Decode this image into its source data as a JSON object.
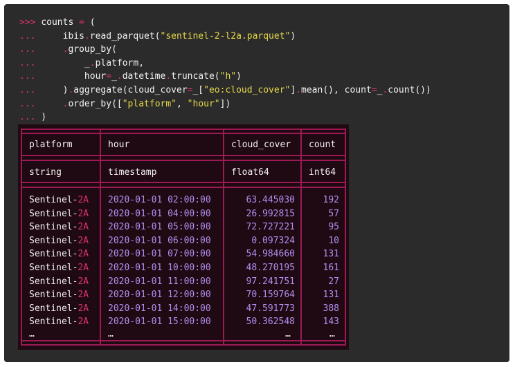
{
  "code": {
    "prompt_primary": ">>>",
    "prompt_continuation": "...",
    "lines": [
      {
        "prompt": ">>>",
        "parts": [
          [
            "fn",
            " counts "
          ],
          [
            "op",
            "="
          ],
          [
            "fn",
            " ("
          ]
        ]
      },
      {
        "prompt": "...",
        "parts": [
          [
            "fn",
            "     ibis"
          ],
          [
            "op",
            "."
          ],
          [
            "fn",
            "read_parquet("
          ],
          [
            "str",
            "\"sentinel-2-l2a.parquet\""
          ],
          [
            "fn",
            ")"
          ]
        ]
      },
      {
        "prompt": "...",
        "parts": [
          [
            "fn",
            "     "
          ],
          [
            "op",
            "."
          ],
          [
            "fn",
            "group_by("
          ]
        ]
      },
      {
        "prompt": "...",
        "parts": [
          [
            "fn",
            "         _"
          ],
          [
            "op",
            "."
          ],
          [
            "fn",
            "platform,"
          ]
        ]
      },
      {
        "prompt": "...",
        "parts": [
          [
            "fn",
            "         hour"
          ],
          [
            "op",
            "="
          ],
          [
            "fn",
            "_"
          ],
          [
            "op",
            "."
          ],
          [
            "fn",
            "datetime"
          ],
          [
            "op",
            "."
          ],
          [
            "fn",
            "truncate("
          ],
          [
            "str",
            "\"h\""
          ],
          [
            "fn",
            ")"
          ]
        ]
      },
      {
        "prompt": "...",
        "parts": [
          [
            "fn",
            "     )"
          ],
          [
            "op",
            "."
          ],
          [
            "fn",
            "aggregate(cloud_cover"
          ],
          [
            "op",
            "="
          ],
          [
            "fn",
            "_["
          ],
          [
            "str",
            "\"eo:cloud_cover\""
          ],
          [
            "fn",
            "]"
          ],
          [
            "op",
            "."
          ],
          [
            "fn",
            "mean(), count"
          ],
          [
            "op",
            "="
          ],
          [
            "fn",
            "_"
          ],
          [
            "op",
            "."
          ],
          [
            "fn",
            "count())"
          ]
        ]
      },
      {
        "prompt": "...",
        "parts": [
          [
            "fn",
            "     "
          ],
          [
            "op",
            "."
          ],
          [
            "fn",
            "order_by(["
          ],
          [
            "str",
            "\"platform\""
          ],
          [
            "fn",
            ", "
          ],
          [
            "str",
            "\"hour\""
          ],
          [
            "fn",
            "])"
          ]
        ]
      },
      {
        "prompt": "...",
        "parts": [
          [
            "fn",
            " )"
          ]
        ]
      }
    ]
  },
  "table": {
    "columns": [
      "platform",
      "hour",
      "cloud_cover",
      "count"
    ],
    "types": [
      "string",
      "timestamp",
      "float64",
      "int64"
    ],
    "rows": [
      {
        "platform_prefix": "Sentinel-",
        "platform_num": "2A",
        "hour": "2020-01-01 02:00:00",
        "cloud_cover": "63.445030",
        "count": "192"
      },
      {
        "platform_prefix": "Sentinel-",
        "platform_num": "2A",
        "hour": "2020-01-01 04:00:00",
        "cloud_cover": "26.992815",
        "count": "57"
      },
      {
        "platform_prefix": "Sentinel-",
        "platform_num": "2A",
        "hour": "2020-01-01 05:00:00",
        "cloud_cover": "72.727221",
        "count": "95"
      },
      {
        "platform_prefix": "Sentinel-",
        "platform_num": "2A",
        "hour": "2020-01-01 06:00:00",
        "cloud_cover": "0.097324",
        "count": "10"
      },
      {
        "platform_prefix": "Sentinel-",
        "platform_num": "2A",
        "hour": "2020-01-01 07:00:00",
        "cloud_cover": "54.984660",
        "count": "131"
      },
      {
        "platform_prefix": "Sentinel-",
        "platform_num": "2A",
        "hour": "2020-01-01 10:00:00",
        "cloud_cover": "48.270195",
        "count": "161"
      },
      {
        "platform_prefix": "Sentinel-",
        "platform_num": "2A",
        "hour": "2020-01-01 11:00:00",
        "cloud_cover": "97.241751",
        "count": "27"
      },
      {
        "platform_prefix": "Sentinel-",
        "platform_num": "2A",
        "hour": "2020-01-01 12:00:00",
        "cloud_cover": "70.159764",
        "count": "131"
      },
      {
        "platform_prefix": "Sentinel-",
        "platform_num": "2A",
        "hour": "2020-01-01 14:00:00",
        "cloud_cover": "47.591773",
        "count": "388"
      },
      {
        "platform_prefix": "Sentinel-",
        "platform_num": "2A",
        "hour": "2020-01-01 15:00:00",
        "cloud_cover": "50.362548",
        "count": "143"
      }
    ],
    "ellipsis": "…"
  },
  "colors": {
    "terminal_bg": "#2b2b2b",
    "table_bg": "#1f0912",
    "border": "#9e1a55",
    "prompt": "#e0336e",
    "string": "#e6d84a",
    "number": "#b48ef0"
  }
}
